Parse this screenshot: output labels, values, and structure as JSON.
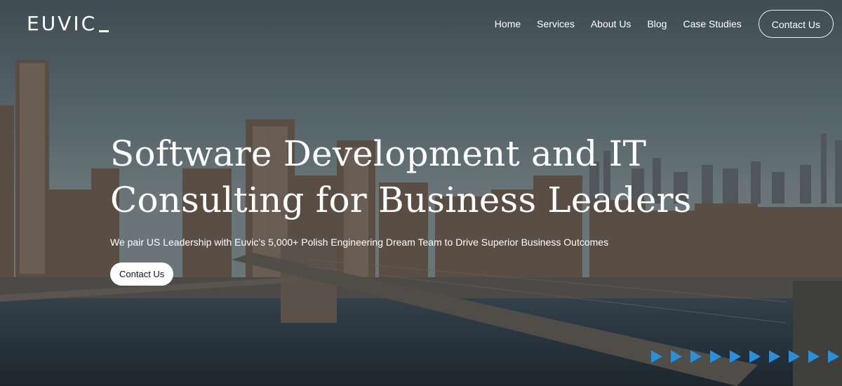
{
  "brand": {
    "logo_text": "EUVIC"
  },
  "nav": {
    "items": [
      "Home",
      "Services",
      "About Us",
      "Blog",
      "Case Studies"
    ],
    "contact_label": "Contact Us"
  },
  "hero": {
    "headline_line1": "Software Development and IT",
    "headline_line2": "Consulting for Business Leaders",
    "subtitle": "We pair US Leadership with Euvic’s 5,000+ Polish Engineering Dream Team to Drive Superior Business Outcomes",
    "cta_label": "Contact Us"
  },
  "colors": {
    "accent_arrows": "#2b8fd8",
    "text": "#ffffff"
  },
  "icons": [
    "arrow-right-icon"
  ]
}
